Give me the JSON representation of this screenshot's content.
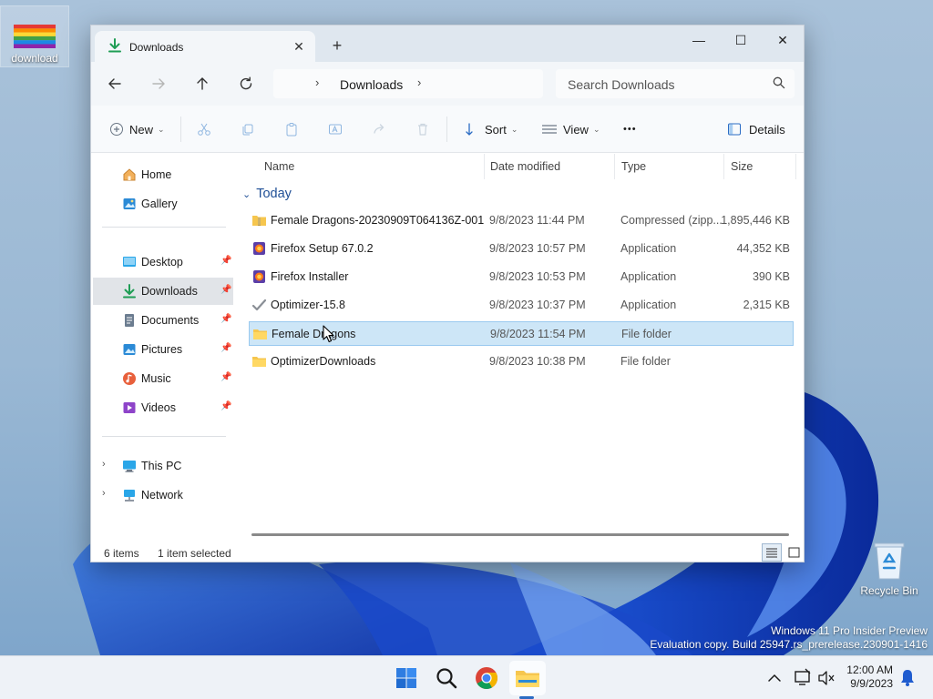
{
  "desktop": {
    "icons": [
      {
        "label": "download"
      },
      {
        "label": "Recycle Bin"
      }
    ],
    "watermark": [
      "Windows 11 Pro Insider Preview",
      "Evaluation copy. Build 25947.rs_prerelease.230901-1416"
    ]
  },
  "window": {
    "tab_title": "Downloads",
    "tab_close": "✕",
    "new_tab": "+",
    "controls": {
      "minimize": "—",
      "maximize": "☐",
      "close": "✕"
    },
    "address": {
      "crumb": "Downloads"
    },
    "search": {
      "placeholder": "Search Downloads"
    },
    "toolbar": {
      "new_label": "New",
      "sort_label": "Sort",
      "view_label": "View",
      "more_label": "•••",
      "details_label": "Details"
    },
    "sidebar": {
      "items": [
        {
          "label": "Home",
          "icon": "home-icon"
        },
        {
          "label": "Gallery",
          "icon": "gallery-icon"
        },
        {
          "label": "Desktop",
          "icon": "desktop-icon",
          "pinned": true
        },
        {
          "label": "Downloads",
          "icon": "download-icon",
          "pinned": true,
          "selected": true
        },
        {
          "label": "Documents",
          "icon": "documents-icon",
          "pinned": true
        },
        {
          "label": "Pictures",
          "icon": "pictures-icon",
          "pinned": true
        },
        {
          "label": "Music",
          "icon": "music-icon",
          "pinned": true
        },
        {
          "label": "Videos",
          "icon": "videos-icon",
          "pinned": true
        },
        {
          "label": "This PC",
          "icon": "pc-icon"
        },
        {
          "label": "Network",
          "icon": "network-icon"
        }
      ]
    },
    "columns": {
      "name": "Name",
      "date": "Date modified",
      "type": "Type",
      "size": "Size"
    },
    "group": "Today",
    "files": [
      {
        "name": "Female Dragons-20230909T064136Z-001",
        "date": "9/8/2023 11:44 PM",
        "type": "Compressed (zipp...",
        "size": "1,895,446 KB"
      },
      {
        "name": "Firefox Setup 67.0.2",
        "date": "9/8/2023 10:57 PM",
        "type": "Application",
        "size": "44,352 KB"
      },
      {
        "name": "Firefox Installer",
        "date": "9/8/2023 10:53 PM",
        "type": "Application",
        "size": "390 KB"
      },
      {
        "name": "Optimizer-15.8",
        "date": "9/8/2023 10:37 PM",
        "type": "Application",
        "size": "2,315 KB"
      },
      {
        "name": "Female Dragons",
        "date": "9/8/2023 11:54 PM",
        "type": "File folder",
        "size": ""
      },
      {
        "name": "OptimizerDownloads",
        "date": "9/8/2023 10:38 PM",
        "type": "File folder",
        "size": ""
      }
    ],
    "status": {
      "count": "6 items",
      "selection": "1 item selected"
    }
  },
  "taskbar": {
    "clock_time": "12:00 AM",
    "clock_date": "9/9/2023"
  }
}
